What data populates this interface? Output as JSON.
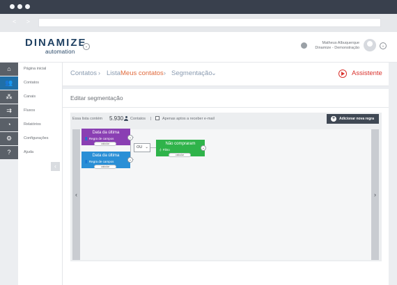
{
  "browser": {
    "nav_arrows": "< >"
  },
  "header": {
    "logo_main": "DINAMIZE",
    "logo_sub": "automation",
    "logo_menu": "⌄",
    "user_name": "Matheus Albuquerque",
    "user_org": "Dinamize - Demonstração",
    "user_menu": "⌄"
  },
  "sidebar": {
    "items": [
      {
        "label": "Página inicial",
        "icon": "home-icon",
        "glyph": "⌂"
      },
      {
        "label": "Contatos",
        "icon": "contacts-icon",
        "glyph": "👥",
        "active": true
      },
      {
        "label": "Canais",
        "icon": "channels-icon",
        "glyph": "⁂"
      },
      {
        "label": "Fluxos",
        "icon": "flows-icon",
        "glyph": "⇉"
      },
      {
        "label": "Relatórios",
        "icon": "reports-icon",
        "glyph": "◔"
      },
      {
        "label": "Configurações",
        "icon": "settings-icon",
        "glyph": "⚙"
      },
      {
        "label": "Ajuda",
        "icon": "help-icon",
        "glyph": "?"
      }
    ],
    "collapse_glyph": "‹"
  },
  "breadcrumb": {
    "root": "Contatos",
    "sep": "›",
    "lists_prefix": "Lista",
    "lists_current": "Meus contatos",
    "current": "Segmentação",
    "current_menu": "⌄",
    "assistant": "Assistente"
  },
  "panel": {
    "title": "Editar segmentação",
    "list_prefix": "Essa lista contém",
    "count": "5.930",
    "count_suffix": "Contatos",
    "divider": "|",
    "checkbox_label": "Apenas aptos a receber e-mail",
    "add_rule": "Adicionar nova regra",
    "add_glyph": "+",
    "scroll_left": "‹",
    "scroll_right": "›"
  },
  "nodes": {
    "rule1": {
      "title": "Data da última",
      "sub": "Regra de campos",
      "pill": "calcular",
      "color": "#8a3fb3"
    },
    "rule2": {
      "title": "Data da última",
      "sub": "Regra de campos",
      "pill": "calcular",
      "color": "#2a8fd6"
    },
    "filter": {
      "title": "Não compraram",
      "sub": "Filtro",
      "pill": "calcular",
      "color": "#2fb34a"
    },
    "operator": "OU",
    "operator_menu": "⌄",
    "toggle": "⌄"
  },
  "colors": {
    "brand": "#214263",
    "active_nav": "#1f6fa8",
    "accent_crumb": "#e06a3c",
    "assistant": "#d9322d",
    "add_button": "#3f4854"
  }
}
